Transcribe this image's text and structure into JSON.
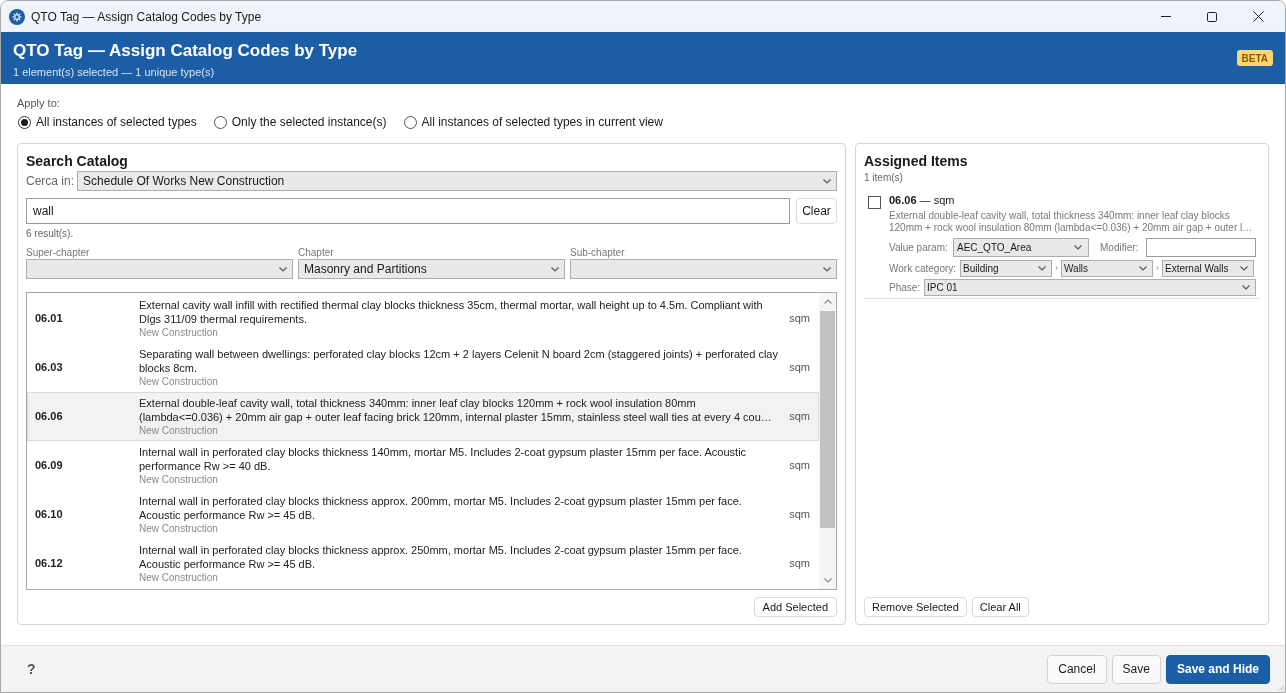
{
  "window": {
    "title": "QTO Tag — Assign Catalog Codes by Type"
  },
  "header": {
    "title": "QTO Tag — Assign Catalog Codes by Type",
    "subtitle": "1 element(s) selected — 1 unique type(s)",
    "badge": "BETA"
  },
  "apply_to": {
    "label": "Apply to:",
    "options": [
      {
        "label": "All instances of selected types",
        "selected": true
      },
      {
        "label": "Only the selected instance(s)",
        "selected": false
      },
      {
        "label": "All instances of selected types in current view",
        "selected": false
      }
    ]
  },
  "search_catalog": {
    "title": "Search Catalog",
    "search_in": {
      "label": "Cerca in:",
      "value": "Schedule Of Works New Construction"
    },
    "search": {
      "value": "wall"
    },
    "clear_button": "Clear",
    "result_count": "6 result(s).",
    "filters": [
      {
        "label": "Super-chapter"
      },
      {
        "label": "Chapter",
        "value": "Masonry and Partitions"
      },
      {
        "label": "Sub-chapter"
      }
    ],
    "rows": [
      {
        "code": "06.01",
        "description": "External cavity wall infill with rectified thermal clay blocks thickness 35cm, thermal mortar, wall height up to 4.5m. Compliant with Dlgs 311/09 thermal requirements.",
        "category": "New Construction",
        "unit": "sqm",
        "selected": false
      },
      {
        "code": "06.03",
        "description": "Separating wall between dwellings: perforated clay blocks 12cm + 2 layers Celenit N board 2cm (staggered joints) + perforated clay blocks 8cm.",
        "category": "New Construction",
        "unit": "sqm",
        "selected": false
      },
      {
        "code": "06.06",
        "description": "External double-leaf cavity wall, total thickness 340mm: inner leaf clay blocks 120mm + rock wool insulation 80mm (lambda<=0.036) + 20mm air gap + outer leaf facing brick 120mm, internal plaster 15mm, stainless steel wall ties at every 4 cou…",
        "category": "New Construction",
        "unit": "sqm",
        "selected": true
      },
      {
        "code": "06.09",
        "description": "Internal wall in perforated clay blocks thickness 140mm, mortar M5. Includes 2-coat gypsum plaster 15mm per face. Acoustic performance Rw >= 40 dB.",
        "category": "New Construction",
        "unit": "sqm",
        "selected": false
      },
      {
        "code": "06.10",
        "description": "Internal wall in perforated clay blocks thickness approx. 200mm, mortar M5. Includes 2-coat gypsum plaster 15mm per face. Acoustic performance Rw >= 45 dB.",
        "category": "New Construction",
        "unit": "sqm",
        "selected": false
      },
      {
        "code": "06.12",
        "description": "Internal wall in perforated clay blocks thickness approx. 250mm, mortar M5. Includes 2-coat gypsum plaster 15mm per face. Acoustic performance Rw >= 45 dB.",
        "category": "New Construction",
        "unit": "sqm",
        "selected": false
      }
    ],
    "add_button": "Add Selected"
  },
  "assigned_items": {
    "title": "Assigned Items",
    "count": "1 item(s)",
    "items": [
      {
        "checked": false,
        "title": "**06.06** — sqm",
        "description": "External double-leaf cavity wall, total thickness 340mm: inner leaf clay blocks 120mm + rock wool insulation 80mm (lambda<=0.036) + 20mm air gap + outer l…",
        "value_param": {
          "label": "Value param:",
          "value": "AEC_QTO_Area"
        },
        "modifier": {
          "label": "Modifier:"
        },
        "work_category": {
          "label": "Work category:",
          "levels": [
            {
              "value": "Building"
            },
            {
              "separator": "›",
              "value": "Walls"
            },
            {
              "separator": "›",
              "value": "External Walls"
            }
          ]
        },
        "phase": {
          "label": "Phase:",
          "value": "IPC 01"
        }
      }
    ],
    "buttons": [
      "Remove Selected",
      "Clear All"
    ]
  },
  "footer": {
    "help": "?",
    "buttons": [
      {
        "label": "Cancel",
        "kind": "secondary"
      },
      {
        "label": "Save",
        "kind": "secondary"
      },
      {
        "label": "Save and Hide",
        "kind": "primary"
      }
    ]
  }
}
